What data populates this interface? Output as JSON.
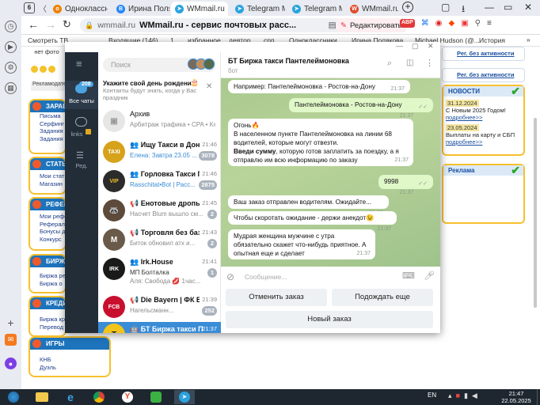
{
  "browser": {
    "tab_counter": "6",
    "tabs": [
      {
        "label": "Одноклассн",
        "icon": "odnoklassniki-icon",
        "color": "#ee8208"
      },
      {
        "label": "Ирина Поля",
        "icon": "vk-icon",
        "color": "#2787f5"
      },
      {
        "label": "WMmail.ru",
        "icon": "telegram-icon",
        "color": "#2aa3de"
      },
      {
        "label": "Telegram Me",
        "icon": "telegram-icon",
        "color": "#2aa3de"
      },
      {
        "label": "Telegram Me",
        "icon": "telegram-icon",
        "color": "#2aa3de"
      },
      {
        "label": "WMmail.ru",
        "icon": "wmmail-icon",
        "color": "#e24a2a"
      }
    ],
    "domain": "wmmail.ru",
    "page_title": "WMmail.ru - сервис почтовых расс...",
    "edit_button": "Редактировать",
    "bookmarks": [
      "Смотреть ТВ",
      "Входящие (146)",
      "1",
      "избранное",
      "деятор",
      "срп",
      "Одноклассники",
      "Ирина Полякова",
      "Michael Hudson (@...",
      "История"
    ]
  },
  "site": {
    "left_menu": [
      {
        "head": "ЗАРАБ",
        "items": [
          "Письма",
          "Серфинг",
          "Задания",
          "Задания"
        ]
      },
      {
        "head": "СТАТЬ",
        "items": [
          "Мои статьи",
          "Магазин"
        ]
      },
      {
        "head": "РЕФЕР",
        "items": [
          "Мои рефер",
          "Реферал",
          "Бонусы д",
          "Конкурс"
        ]
      },
      {
        "head": "БИРЖ",
        "items": [
          "Биржа ре",
          "Биржа о"
        ]
      },
      {
        "head": "КРЕДИ",
        "items": [
          "Биржа кр",
          "Перевод"
        ]
      },
      {
        "head": "ИГРЫ",
        "items": [
          "КНБ",
          "Дуэль"
        ]
      }
    ],
    "no_photo": "нет фото",
    "ad_label": "Рекламодате",
    "right": {
      "no_activity_1": "Рег. без активности",
      "no_activity_2": "Рег. без активности",
      "news_head": "НОВОСТИ",
      "news": [
        {
          "date": "31.12.2024",
          "text": "С Новым 2025 Годом!",
          "more": "подробнее>>"
        },
        {
          "date": "23.05.2024",
          "text": "Выплаты на карту и СБП",
          "more": "подробнее>>"
        }
      ],
      "ads_head": "Реклама"
    }
  },
  "telegram": {
    "nav": {
      "all_chats": "Все чаты",
      "all_badge": "208",
      "links": "links",
      "edit": "Ред."
    },
    "search_placeholder": "Поиск",
    "birthday": {
      "title": "Укажите свой день рождения!",
      "text": "Контакты будут знать, когда у Вас праздник"
    },
    "archive": {
      "title": "Архив",
      "preview": "Арбитраж трафика • CPA • Ke..."
    },
    "chats": [
      {
        "name": "Ищу Такси в Дон...",
        "time": "21:46",
        "preview": "Елена: Завтра 23.05 ...",
        "badge": "3078",
        "avatar": "TAXI",
        "color": "#d6a21a"
      },
      {
        "name": "Горловка Такси Г...",
        "time": "21:46",
        "preview": "Rasschitat•Bot | Расс...",
        "badge": "2875",
        "avatar": "VIP",
        "color": "#2b2b2b"
      },
      {
        "name": "Енотовые дропы",
        "time": "21:45",
        "preview": "Насчет Blum вышло см...",
        "badge": "2",
        "avatar": "🦝",
        "color": "#5e4a3a"
      },
      {
        "name": "Торговля без баз...",
        "time": "21:43",
        "preview": "Биток обновил атх и...",
        "badge": "2",
        "avatar": "М",
        "color": "#6a5a4a"
      },
      {
        "name": "Irk.House",
        "time": "21:41",
        "preview": "МП  Болталка",
        "preview2": "Аля: Свобода 💋 1час...",
        "badge": "1",
        "avatar": "IRK",
        "color": "#1a1a1a"
      },
      {
        "name": "Die Bayern | ФК Б...",
        "time": "21:39",
        "preview": "Нагельсманн...",
        "badge": "252",
        "avatar": "FCB",
        "color": "#c8102e"
      },
      {
        "name": "БТ Биржа такси П...",
        "time": "21:37",
        "preview": "",
        "badge": "",
        "avatar": "T",
        "color": "#f0c419"
      }
    ],
    "chat": {
      "title": "БТ Биржа такси Пантелеймоновка",
      "subtitle": "бот",
      "messages": [
        {
          "dir": "in",
          "text": "Например: Пантелеймоновка - Ростов-на-Дону",
          "time": "21:37"
        },
        {
          "dir": "out",
          "text": "Пантелеймоновка - Ростов-на-Дону",
          "time": "21:37"
        },
        {
          "dir": "in",
          "line1": "Огонь🔥",
          "line2": "В населенном пункте Пантелеймоновка на линии 68 водителей, которые могут отвезти.",
          "bold": "Введи сумму",
          "line3": ", которую готов заплатить за поездку, а я отправлю им всю информацию по заказу",
          "time": "21:37"
        },
        {
          "dir": "out",
          "text": "9998",
          "time": "21:37"
        },
        {
          "dir": "in",
          "text": "Ваш заказ отправлен водителям. Ожидайте...",
          "time": "21:37"
        },
        {
          "dir": "in",
          "text": "Чтобы скоротать ожидание - держи анекдот😉",
          "time": "21:37"
        },
        {
          "dir": "in",
          "text": "Мудрая женщина мужчине с утра обязательно скажет что-нибудь приятное. А опытная еще и сделает",
          "time": "21:37"
        }
      ],
      "input_placeholder": "Сообщение...",
      "buttons": {
        "cancel": "Отменить заказ",
        "wait": "Подождать еще",
        "new": "Новый заказ"
      }
    }
  },
  "taskbar": {
    "lang": "EN",
    "time": "21:47",
    "date": "22.05.2025"
  }
}
